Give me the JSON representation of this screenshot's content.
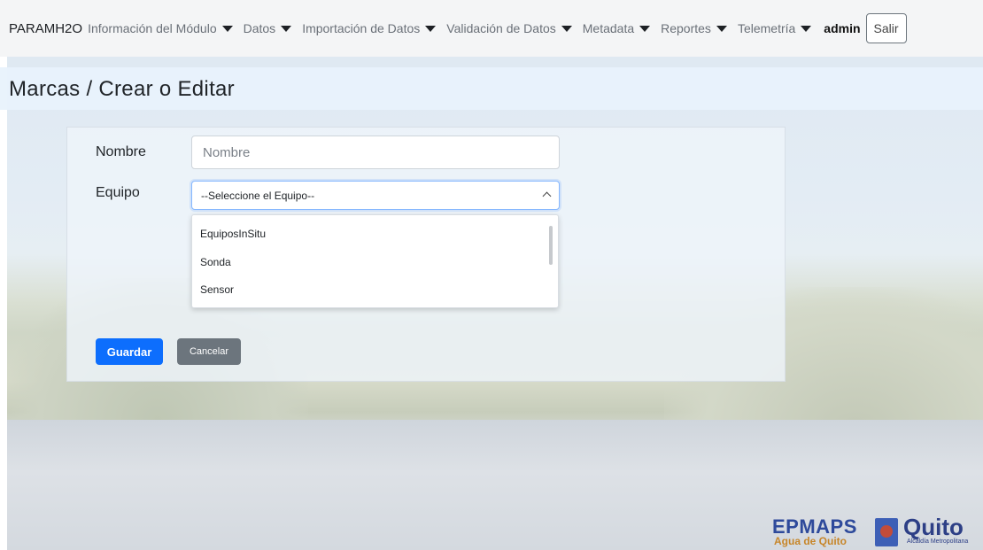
{
  "nav": {
    "brand": "PARAMH2O",
    "items": [
      {
        "label": "Información del Módulo",
        "has_caret": true
      },
      {
        "label": "Datos",
        "has_caret": true
      },
      {
        "label": "Importación de Datos",
        "has_caret": true
      },
      {
        "label": "Validación de Datos",
        "has_caret": true
      },
      {
        "label": "Metadata",
        "has_caret": true
      },
      {
        "label": "Reportes",
        "has_caret": true
      },
      {
        "label": "Telemetría",
        "has_caret": true
      }
    ],
    "user": "admin",
    "logout_label": "Salir"
  },
  "page": {
    "title": "Marcas / Crear o Editar"
  },
  "form": {
    "nombre_label": "Nombre",
    "nombre_placeholder": "Nombre",
    "nombre_value": "",
    "equipo_label": "Equipo",
    "equipo_selected": "--Seleccione el Equipo--",
    "equipo_options": [
      "EquiposInSitu",
      "Sonda",
      "Sensor"
    ],
    "save_label": "Guardar",
    "cancel_label": "Cancelar"
  },
  "logo": {
    "name": "EPMAPS",
    "tagline": "Agua de Quito",
    "city": "Quito",
    "sub": "Alcaldía Metropolitana"
  },
  "colors": {
    "primary": "#0d6efd",
    "secondary": "#6c757d",
    "navbar_bg": "#f4f5f6",
    "title_band": "#e8f2fc"
  }
}
